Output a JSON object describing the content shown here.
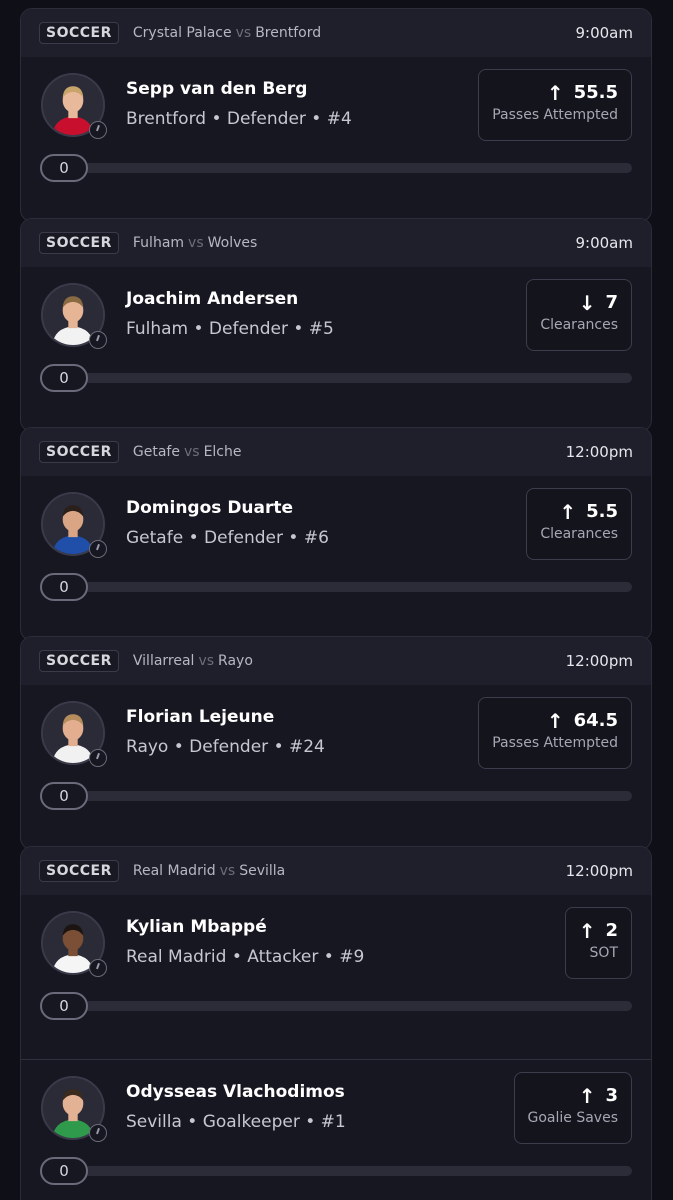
{
  "games": [
    {
      "sport": "SOCCER",
      "home": "Crystal Palace",
      "away": "Brentford",
      "vs": "vs",
      "time": "9:00am",
      "players": [
        {
          "name": "Sepp van den Berg",
          "meta": "Brentford • Defender • #4",
          "direction": "up",
          "arrow": "↑",
          "line": "55.5",
          "stat": "Passes Attempted",
          "current": "0",
          "progress": 0,
          "kit_color": "#c8102e",
          "skin": "#e8b99a",
          "hair": "#c9a46a"
        }
      ]
    },
    {
      "sport": "SOCCER",
      "home": "Fulham",
      "away": "Wolves",
      "vs": "vs",
      "time": "9:00am",
      "players": [
        {
          "name": "Joachim Andersen",
          "meta": "Fulham • Defender • #5",
          "direction": "down",
          "arrow": "↓",
          "line": "7",
          "stat": "Clearances",
          "current": "0",
          "progress": 0,
          "kit_color": "#f2f2f2",
          "skin": "#e6b596",
          "hair": "#8a6a43"
        }
      ]
    },
    {
      "sport": "SOCCER",
      "home": "Getafe",
      "away": "Elche",
      "vs": "vs",
      "time": "12:00pm",
      "players": [
        {
          "name": "Domingos Duarte",
          "meta": "Getafe • Defender • #6",
          "direction": "up",
          "arrow": "↑",
          "line": "5.5",
          "stat": "Clearances",
          "current": "0",
          "progress": 0,
          "kit_color": "#1f4fa8",
          "skin": "#d9a584",
          "hair": "#2b2019"
        }
      ]
    },
    {
      "sport": "SOCCER",
      "home": "Villarreal",
      "away": "Rayo",
      "vs": "vs",
      "time": "12:00pm",
      "players": [
        {
          "name": "Florian Lejeune",
          "meta": "Rayo • Defender • #24",
          "direction": "up",
          "arrow": "↑",
          "line": "64.5",
          "stat": "Passes Attempted",
          "current": "0",
          "progress": 0,
          "kit_color": "#f1f1f1",
          "skin": "#e2ae8f",
          "hair": "#b58d5c"
        }
      ]
    },
    {
      "sport": "SOCCER",
      "home": "Real Madrid",
      "away": "Sevilla",
      "vs": "vs",
      "time": "12:00pm",
      "players": [
        {
          "name": "Kylian Mbappé",
          "meta": "Real Madrid • Attacker • #9",
          "direction": "up",
          "arrow": "↑",
          "line": "2",
          "stat": "SOT",
          "current": "0",
          "progress": 0,
          "kit_color": "#f5f5f5",
          "skin": "#7a4f35",
          "hair": "#1c1411"
        },
        {
          "name": "Odysseas Vlachodimos",
          "meta": "Sevilla • Goalkeeper • #1",
          "direction": "up",
          "arrow": "↑",
          "line": "3",
          "stat": "Goalie Saves",
          "current": "0",
          "progress": 0,
          "kit_color": "#2f9a4b",
          "skin": "#e3b194",
          "hair": "#3b2a1e"
        }
      ]
    }
  ]
}
